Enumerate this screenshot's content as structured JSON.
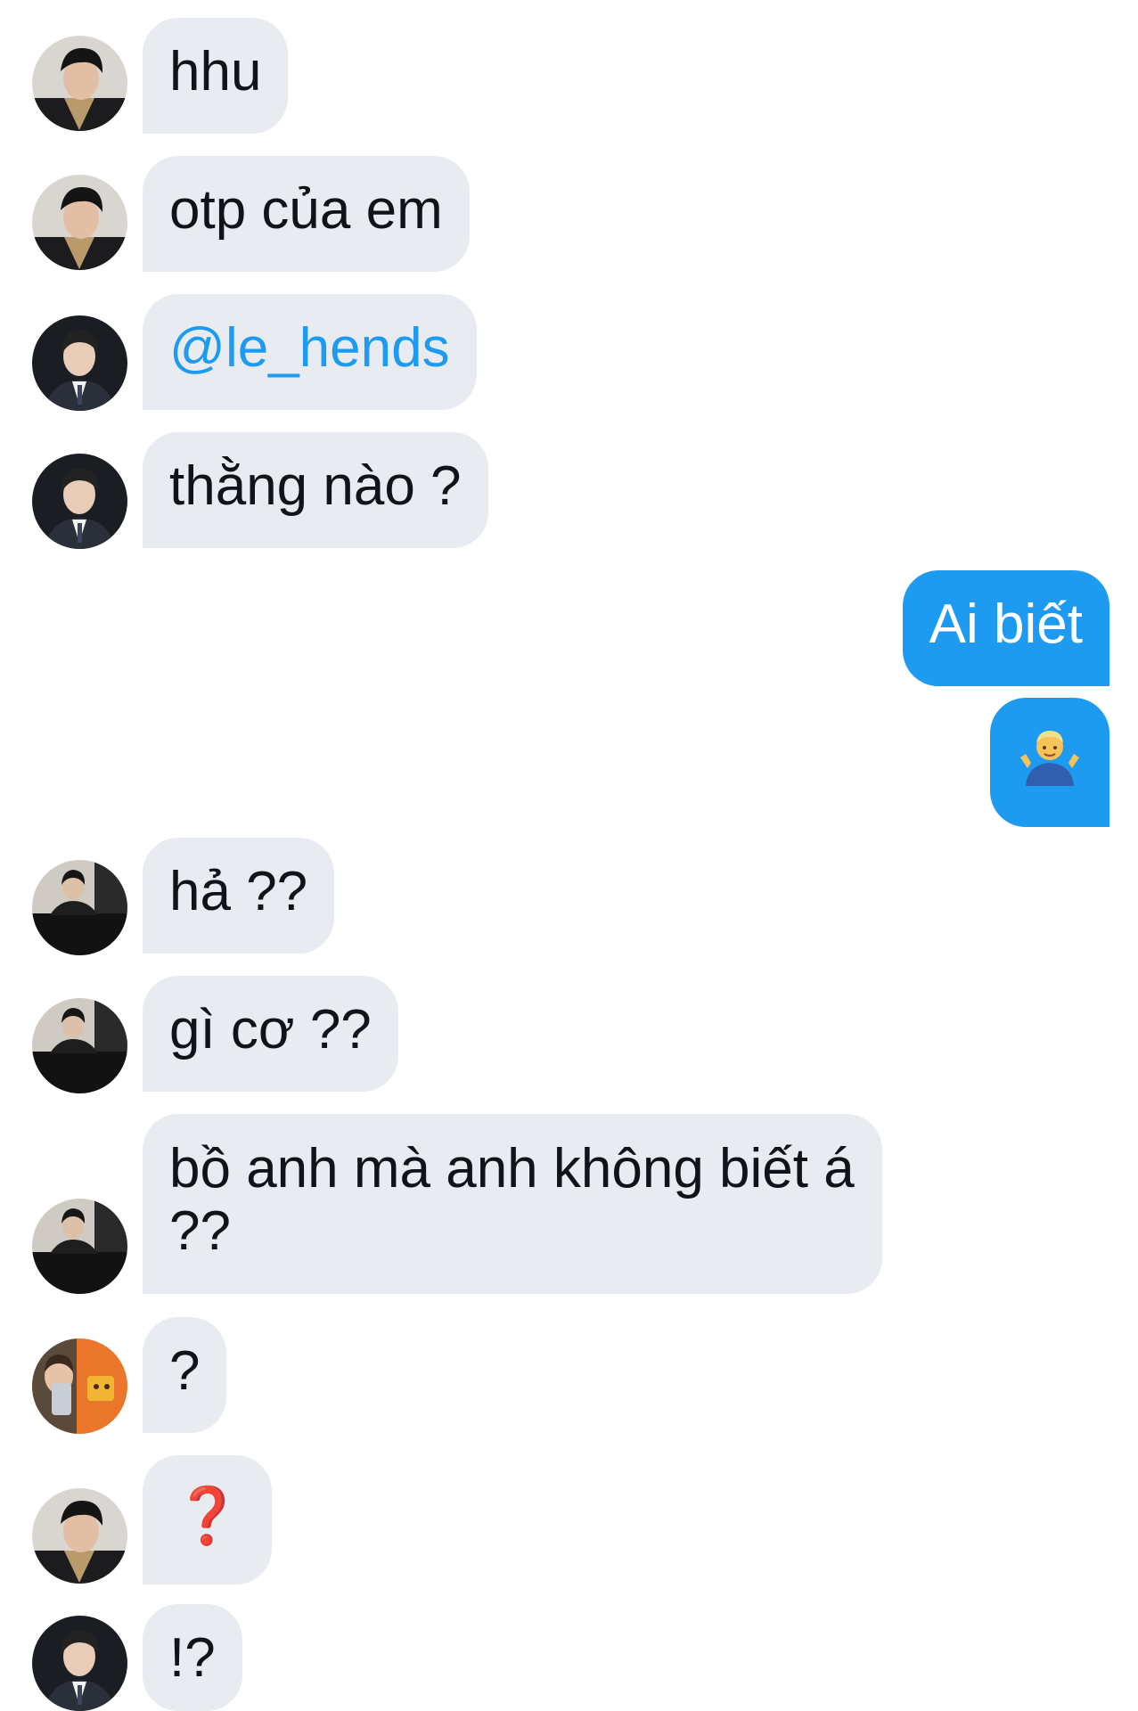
{
  "messages": [
    {
      "side": "left",
      "avatar": "avatar-scarf-boy",
      "text": "hhu"
    },
    {
      "side": "left",
      "avatar": "avatar-scarf-boy",
      "text": "otp của em"
    },
    {
      "side": "left",
      "avatar": "avatar-suit-boy",
      "text": "@le_hends",
      "mention": true
    },
    {
      "side": "left",
      "avatar": "avatar-suit-boy",
      "text": "thằng nào ?"
    },
    {
      "side": "right",
      "text": "Ai biết"
    },
    {
      "side": "right",
      "emoji": "person-shrugging-icon"
    },
    {
      "side": "left",
      "avatar": "avatar-leather-jacket-boy",
      "text": "hả ??"
    },
    {
      "side": "left",
      "avatar": "avatar-leather-jacket-boy",
      "text": "gì cơ ??"
    },
    {
      "side": "left",
      "avatar": "avatar-leather-jacket-boy",
      "text": "bồ anh mà anh không biết á ??"
    },
    {
      "side": "left",
      "avatar": "avatar-selfie-orange",
      "text": "?"
    },
    {
      "side": "left",
      "avatar": "avatar-scarf-boy",
      "text": "❓",
      "style": "red-question"
    },
    {
      "side": "left",
      "avatar": "avatar-suit-boy",
      "text": "!?"
    }
  ],
  "colors": {
    "incoming_bubble": "#e8ecf0",
    "outgoing_bubble": "#1d9bf0",
    "mention": "#1d9bf0",
    "red_question": "#d8201e"
  }
}
